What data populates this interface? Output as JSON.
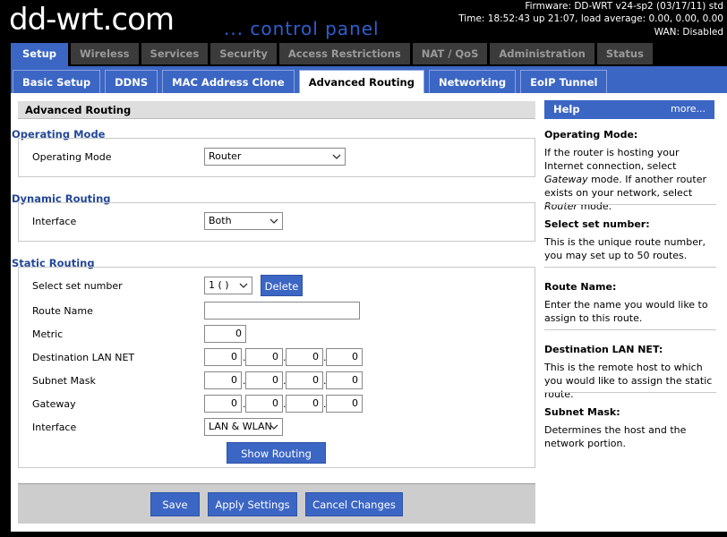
{
  "header": {
    "logo_main": "dd-wrt",
    "logo_suffix": ".com",
    "subtitle": "... control panel",
    "firmware": "Firmware: DD-WRT v24-sp2 (03/17/11) std",
    "time": "Time: 18:52:43 up 21:07, load average: 0.00, 0.00, 0.00",
    "wan": "WAN: Disabled"
  },
  "main_tabs": [
    "Setup",
    "Wireless",
    "Services",
    "Security",
    "Access Restrictions",
    "NAT / QoS",
    "Administration",
    "Status"
  ],
  "sub_tabs": [
    "Basic Setup",
    "DDNS",
    "MAC Address Clone",
    "Advanced Routing",
    "Networking",
    "EoIP Tunnel"
  ],
  "page_title": "Advanced Routing",
  "operating_mode": {
    "section_title": "Operating Mode",
    "label": "Operating Mode",
    "value": "Router"
  },
  "dynamic_routing": {
    "section_title": "Dynamic Routing",
    "label": "Interface",
    "value": "Both"
  },
  "static_routing": {
    "section_title": "Static Routing",
    "set_number_label": "Select set number",
    "set_number_value": "1 ( )",
    "delete_button": "Delete",
    "route_name_label": "Route Name",
    "route_name_value": "",
    "metric_label": "Metric",
    "metric_value": "0",
    "dest_label": "Destination LAN NET",
    "dest": [
      "0",
      "0",
      "0",
      "0"
    ],
    "mask_label": "Subnet Mask",
    "mask": [
      "0",
      "0",
      "0",
      "0"
    ],
    "gateway_label": "Gateway",
    "gateway": [
      "0",
      "0",
      "0",
      "0"
    ],
    "interface_label": "Interface",
    "interface_value": "LAN & WLAN",
    "show_table_button": "Show Routing Table"
  },
  "buttons": {
    "save": "Save",
    "apply": "Apply Settings",
    "cancel": "Cancel Changes"
  },
  "help": {
    "title": "Help",
    "more": "more...",
    "items": [
      {
        "head": "Operating Mode:",
        "text_html": "If the router is hosting your Internet connection, select <i>Gateway</i> mode. If another router exists on your network, select <i>Router</i> mode."
      },
      {
        "head": "Select set number:",
        "text_html": "This is the unique route number, you may set up to 50 routes."
      },
      {
        "head": "Route Name:",
        "text_html": "Enter the name you would like to assign to this route."
      },
      {
        "head": "Destination LAN NET:",
        "text_html": "This is the remote host to which you would like to assign the static route."
      },
      {
        "head": "Subnet Mask:",
        "text_html": "Determines the host and the network portion."
      }
    ]
  },
  "colors": {
    "accent": "#3c66c4",
    "section_title": "#23479a",
    "inactive_tab": "#3b3b3b"
  }
}
